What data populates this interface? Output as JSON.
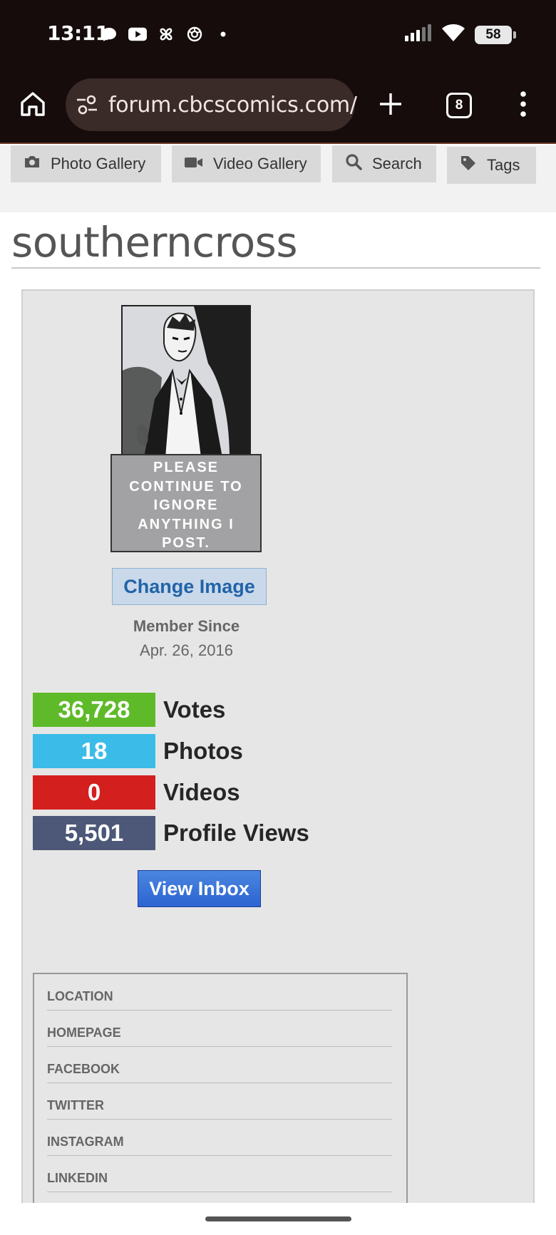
{
  "status_bar": {
    "time": "13:11",
    "notification_icons": [
      "chat-bubble-icon",
      "youtube-icon",
      "pinwheel-icon",
      "rose-icon",
      "dot-icon"
    ],
    "battery_level": "58",
    "signal_icon": "signal-icon",
    "wifi_icon": "wifi-icon"
  },
  "browser": {
    "url": "forum.cbcscomics.com/",
    "tab_count": "8",
    "home_icon": "home-icon",
    "site_settings_icon": "tune-icon",
    "new_tab_icon": "plus-icon",
    "menu_icon": "kebab-menu-icon"
  },
  "nav": {
    "items": [
      {
        "label": "Photo Gallery",
        "icon": "camera-icon"
      },
      {
        "label": "Video Gallery",
        "icon": "video-camera-icon"
      },
      {
        "label": "Search",
        "icon": "search-icon"
      },
      {
        "label": "Tags",
        "icon": "tag-icon"
      }
    ]
  },
  "profile": {
    "username": "southerncross",
    "avatar_caption": "PLEASE CONTINUE TO IGNORE ANYTHING I POST.",
    "change_image_label": "Change Image",
    "member_since_label": "Member Since",
    "member_since_date": "Apr. 26, 2016",
    "stats": [
      {
        "value": "36,728",
        "label": "Votes",
        "color": "#5fba2a"
      },
      {
        "value": "18",
        "label": "Photos",
        "color": "#3bbce8"
      },
      {
        "value": "0",
        "label": "Videos",
        "color": "#d41f1f"
      },
      {
        "value": "5,501",
        "label": "Profile Views",
        "color": "#4d5878"
      }
    ],
    "view_inbox_label": "View Inbox"
  },
  "social_fields": [
    "LOCATION",
    "HOMEPAGE",
    "FACEBOOK",
    "TWITTER",
    "INSTAGRAM",
    "LINKEDIN"
  ],
  "colors": {
    "chrome_background": "#160c0c",
    "url_box": "#3a2b28",
    "link_blue": "#2163a8",
    "inbox_button": "#2d64d2"
  }
}
